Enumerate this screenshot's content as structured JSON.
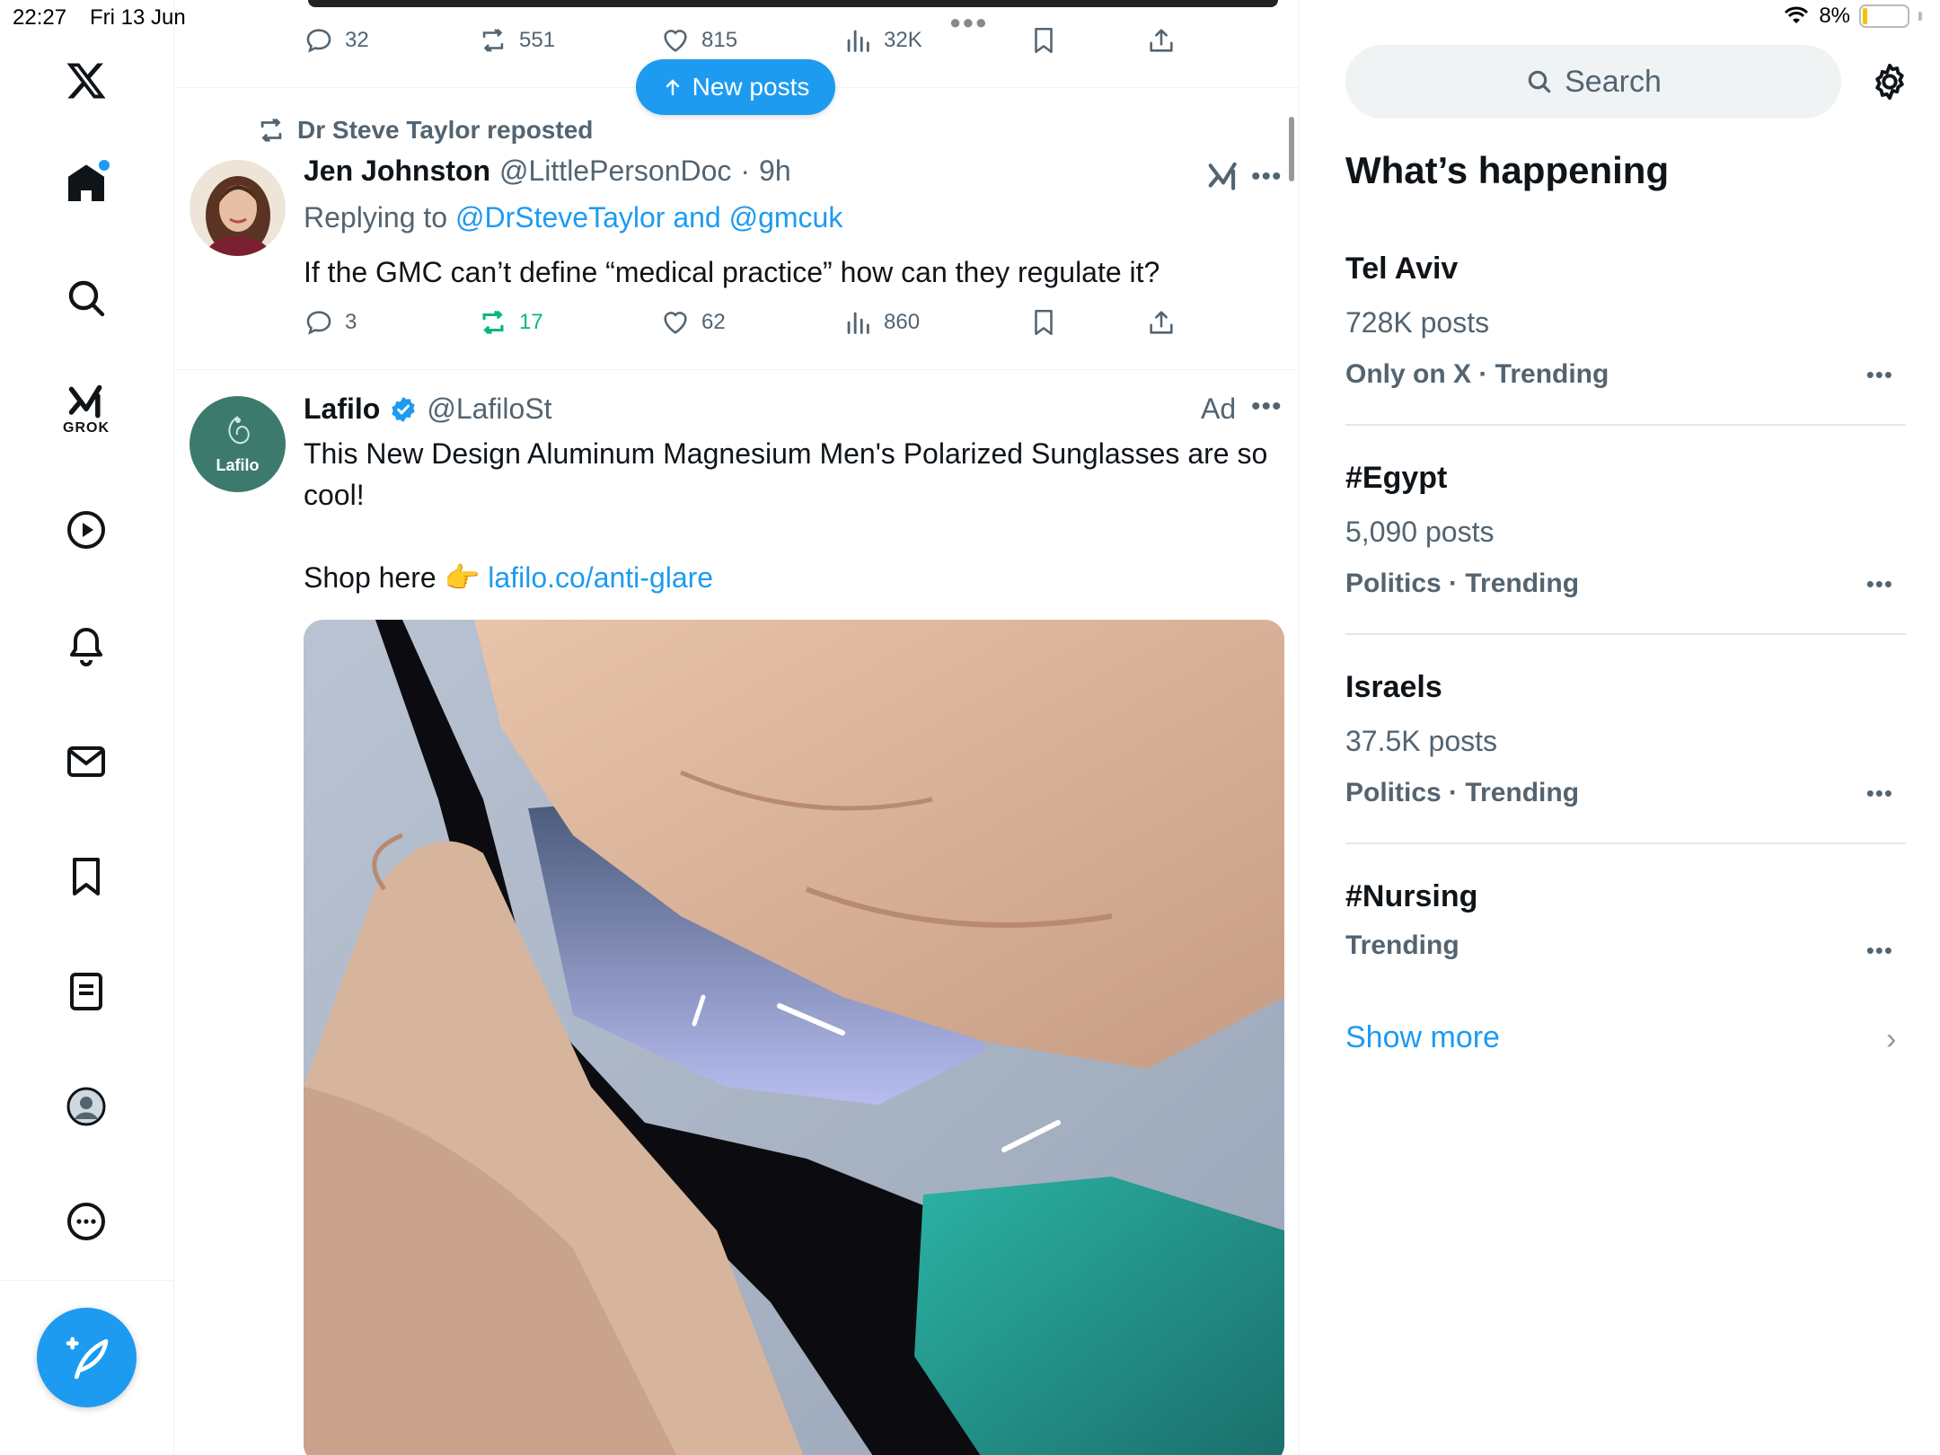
{
  "status_bar": {
    "time": "22:27",
    "date": "Fri 13 Jun",
    "battery": "8%"
  },
  "nav": {
    "items": [
      "home",
      "explore",
      "grok",
      "video",
      "notifications",
      "messages",
      "bookmarks",
      "lists",
      "profile",
      "more"
    ],
    "grok_label": "GROK",
    "accent_color": "#1d9bf0"
  },
  "timeline": {
    "new_posts_label": "New posts",
    "prev_post_actions": {
      "replies": "32",
      "reposts": "551",
      "likes": "815",
      "views": "32K"
    },
    "post1": {
      "repost_by": "Dr Steve Taylor reposted",
      "name": "Jen Johnston",
      "handle": "@LittlePersonDoc",
      "sep": "·",
      "time": "9h",
      "replying_prefix": "Replying to ",
      "replying_to": "@DrSteveTaylor and @gmcuk",
      "text": "If the GMC can’t define “medical practice” how can they regulate it?",
      "actions": {
        "replies": "3",
        "reposts": "17",
        "likes": "62",
        "views": "860"
      }
    },
    "post2": {
      "name": "Lafilo",
      "handle": "@LafiloSt",
      "ad_label": "Ad",
      "avatar_text": "Lafilo",
      "text_line1": "This New Design Aluminum Magnesium Men's Polarized Sunglasses are so cool!",
      "shop_prefix": "Shop here 👉 ",
      "shop_link": "lafilo.co/anti-glare"
    }
  },
  "sidebar": {
    "search_placeholder": "Search",
    "section_title": "What’s happening",
    "trends": [
      {
        "name": "Tel Aviv",
        "count": "728K posts",
        "meta": "Only on X · Trending"
      },
      {
        "name": "#Egypt",
        "count": "5,090 posts",
        "meta": "Politics · Trending"
      },
      {
        "name": "Israels",
        "count": "37.5K posts",
        "meta": "Politics · Trending"
      },
      {
        "name": "#Nursing",
        "count": "",
        "meta": "Trending"
      }
    ],
    "show_more": "Show more"
  }
}
